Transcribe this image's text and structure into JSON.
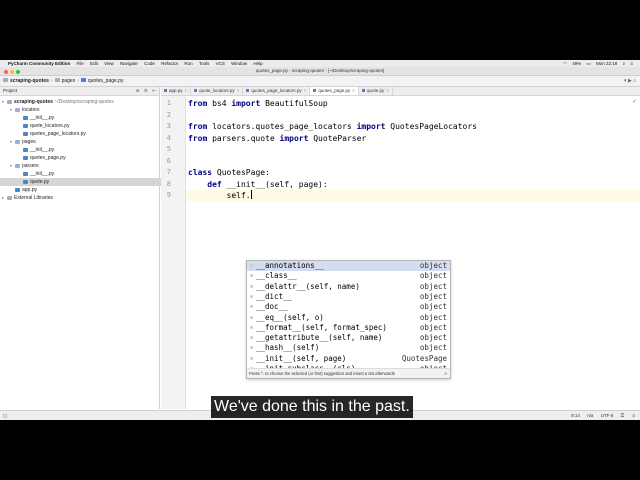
{
  "menubar": {
    "app": "PyCharm Community Edition",
    "items": [
      "File",
      "Edit",
      "View",
      "Navigate",
      "Code",
      "Refactor",
      "Run",
      "Tools",
      "VCS",
      "Window",
      "Help"
    ],
    "battery": "49%",
    "clock": "Mon 22:18"
  },
  "window": {
    "title": "quotes_page.py - scraping-quotes - [~/Desktop/scraping-quotes]"
  },
  "breadcrumb": [
    "scraping-quotes",
    "pages",
    "quotes_page.py"
  ],
  "project_panel": {
    "title": "Project",
    "tree": [
      {
        "label": "scraping-quotes",
        "path": "~/Desktop/scraping-quotes",
        "kind": "folder",
        "depth": 0,
        "expanded": true
      },
      {
        "label": "locators",
        "kind": "folder",
        "depth": 1,
        "expanded": true
      },
      {
        "label": "__init__.py",
        "kind": "py",
        "depth": 2
      },
      {
        "label": "quote_locators.py",
        "kind": "py",
        "depth": 2
      },
      {
        "label": "quotes_page_locators.py",
        "kind": "py",
        "depth": 2
      },
      {
        "label": "pages",
        "kind": "folder",
        "depth": 1,
        "expanded": true
      },
      {
        "label": "__init__.py",
        "kind": "py",
        "depth": 2
      },
      {
        "label": "quotes_page.py",
        "kind": "py",
        "depth": 2
      },
      {
        "label": "parsers",
        "kind": "folder",
        "depth": 1,
        "expanded": true
      },
      {
        "label": "__init__.py",
        "kind": "py",
        "depth": 2
      },
      {
        "label": "quote.py",
        "kind": "py",
        "depth": 2,
        "selected": true
      },
      {
        "label": "app.py",
        "kind": "py",
        "depth": 1
      },
      {
        "label": "External Libraries",
        "kind": "lib",
        "depth": 0,
        "expanded": false
      }
    ]
  },
  "tabs": [
    {
      "label": "app.py",
      "active": false
    },
    {
      "label": "quote_locators.py",
      "active": false
    },
    {
      "label": "quotes_page_locators.py",
      "active": false
    },
    {
      "label": "quotes_page.py",
      "active": true
    },
    {
      "label": "quote.py",
      "active": false
    }
  ],
  "editor": {
    "lines": [
      {
        "n": "1",
        "tokens": [
          {
            "t": "from",
            "k": true
          },
          {
            "t": " bs4 "
          },
          {
            "t": "import",
            "k": true
          },
          {
            "t": " BeautifulSoup"
          }
        ]
      },
      {
        "n": "2",
        "tokens": []
      },
      {
        "n": "3",
        "tokens": [
          {
            "t": "from",
            "k": true
          },
          {
            "t": " locators.quotes_page_locators "
          },
          {
            "t": "import",
            "k": true
          },
          {
            "t": " QuotesPageLocators"
          }
        ]
      },
      {
        "n": "4",
        "tokens": [
          {
            "t": "from",
            "k": true
          },
          {
            "t": " parsers.quote "
          },
          {
            "t": "import",
            "k": true
          },
          {
            "t": " QuoteParser"
          }
        ]
      },
      {
        "n": "5",
        "tokens": []
      },
      {
        "n": "6",
        "tokens": []
      },
      {
        "n": "7",
        "tokens": [
          {
            "t": "class",
            "k": true
          },
          {
            "t": " QuotesPage:"
          }
        ]
      },
      {
        "n": "8",
        "tokens": [
          {
            "t": "    "
          },
          {
            "t": "def",
            "k": true
          },
          {
            "t": " __init__(self, page):"
          }
        ]
      },
      {
        "n": "9",
        "tokens": [
          {
            "t": "        self."
          }
        ],
        "current": true
      }
    ]
  },
  "completion": {
    "items": [
      {
        "name": "__annotations__",
        "type": "object",
        "selected": true
      },
      {
        "name": "__class__",
        "type": "object"
      },
      {
        "name": "__delattr__(self, name)",
        "type": "object"
      },
      {
        "name": "__dict__",
        "type": "object"
      },
      {
        "name": "__doc__",
        "type": "object"
      },
      {
        "name": "__eq__(self, o)",
        "type": "object"
      },
      {
        "name": "__format__(self, format_spec)",
        "type": "object"
      },
      {
        "name": "__getattribute__(self, name)",
        "type": "object"
      },
      {
        "name": "__hash__(self)",
        "type": "object"
      },
      {
        "name": "__init__(self, page)",
        "type": "QuotesPage"
      },
      {
        "name": "__init_subclass__(cls)",
        "type": "object"
      }
    ],
    "hint": "Press ^. to choose the selected (or first) suggestion and insert a dot afterwards"
  },
  "statusbar": {
    "position": "9:14",
    "line_sep": "n/a",
    "encoding": "UTF-8"
  },
  "subtitle": "We've done this in the past."
}
